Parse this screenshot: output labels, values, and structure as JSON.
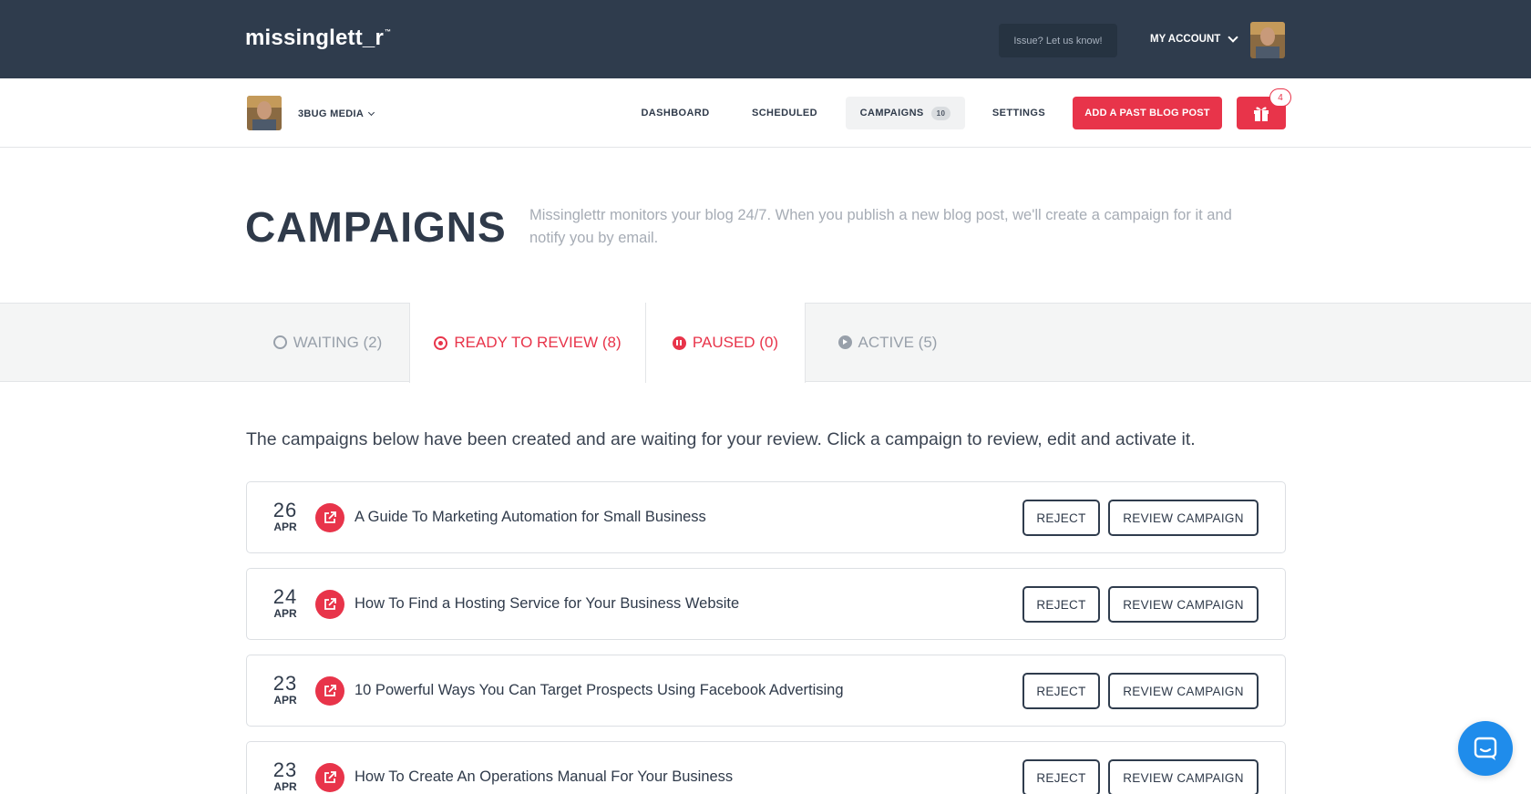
{
  "brand": {
    "logo": "missinglett_r",
    "logo_tm": "™",
    "accent": "#e8344a",
    "header_bg": "#2f3c4d"
  },
  "topbar": {
    "issue_label": "Issue? Let us know!",
    "account_label": "MY ACCOUNT"
  },
  "subnav": {
    "org_name": "3BUG MEDIA",
    "items": [
      {
        "label": "DASHBOARD"
      },
      {
        "label": "SCHEDULED"
      },
      {
        "label": "CAMPAIGNS",
        "count": "10",
        "active": true
      },
      {
        "label": "SETTINGS"
      }
    ],
    "add_post_label": "ADD A PAST BLOG POST",
    "gift_count": "4"
  },
  "header": {
    "title": "CAMPAIGNS",
    "description": "Missinglettr monitors your blog 24/7. When you publish a new blog post, we'll create a campaign for it and notify you by email."
  },
  "tabs": [
    {
      "label": "WAITING (2)",
      "icon": "circle-outline-icon",
      "color": "#98a0aa"
    },
    {
      "label": "READY TO REVIEW (8)",
      "icon": "target-icon",
      "color": "#e8344a",
      "selected": true
    },
    {
      "label": "PAUSED (0)",
      "icon": "pause-circle-icon",
      "color": "#e8344a"
    },
    {
      "label": "ACTIVE (5)",
      "icon": "play-circle-icon",
      "color": "#98a0aa"
    }
  ],
  "intro": "The campaigns below have been created and are waiting for your review. Click a campaign to review, edit and activate it.",
  "campaigns": [
    {
      "day": "26",
      "month": "APR",
      "title": "A Guide To Marketing Automation for Small Business",
      "reject": "REJECT",
      "review": "REVIEW CAMPAIGN"
    },
    {
      "day": "24",
      "month": "APR",
      "title": "How To Find a Hosting Service for Your Business Website",
      "reject": "REJECT",
      "review": "REVIEW CAMPAIGN"
    },
    {
      "day": "23",
      "month": "APR",
      "title": "10 Powerful Ways You Can Target Prospects Using Facebook Advertising",
      "reject": "REJECT",
      "review": "REVIEW CAMPAIGN"
    },
    {
      "day": "23",
      "month": "APR",
      "title": "How To Create An Operations Manual For Your Business",
      "reject": "REJECT",
      "review": "REVIEW CAMPAIGN"
    }
  ]
}
